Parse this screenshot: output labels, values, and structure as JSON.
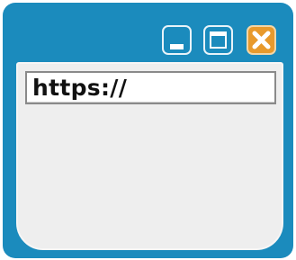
{
  "address_bar": {
    "value": "https://"
  },
  "title_bar": {
    "controls": [
      {
        "name": "minimize",
        "icon": "minimize-icon"
      },
      {
        "name": "maximize",
        "icon": "maximize-icon"
      },
      {
        "name": "close",
        "icon": "close-icon"
      }
    ]
  },
  "colors": {
    "window_frame": "#1b8bbd",
    "close_button": "#e89a2c",
    "content_area": "#eeeeee",
    "address_bar_background": "#ffffff"
  }
}
